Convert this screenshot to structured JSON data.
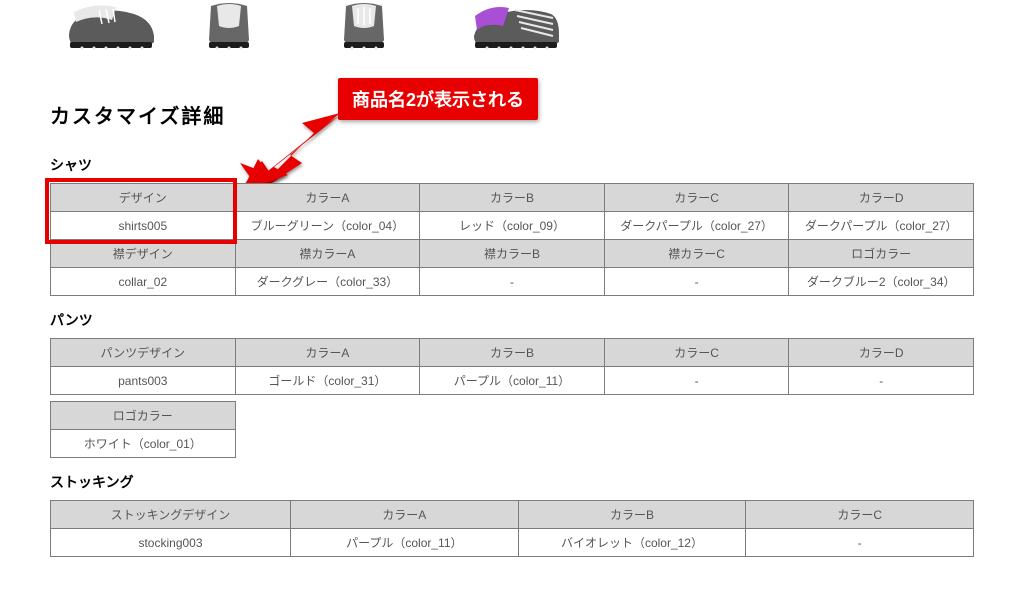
{
  "callout_text": "商品名2が表示される",
  "section_title": "カスタマイズ詳細",
  "shirts": {
    "label": "シャツ",
    "row1_headers": [
      "デザイン",
      "カラーA",
      "カラーB",
      "カラーC",
      "カラーD"
    ],
    "row1_values": [
      "shirts005",
      "ブルーグリーン（color_04）",
      "レッド（color_09）",
      "ダークパープル（color_27）",
      "ダークパープル（color_27）"
    ],
    "row2_headers": [
      "襟デザイン",
      "襟カラーA",
      "襟カラーB",
      "襟カラーC",
      "ロゴカラー"
    ],
    "row2_values": [
      "collar_02",
      "ダークグレー（color_33）",
      "-",
      "-",
      "ダークブルー2（color_34）"
    ]
  },
  "pants": {
    "label": "パンツ",
    "row1_headers": [
      "パンツデザイン",
      "カラーA",
      "カラーB",
      "カラーC",
      "カラーD"
    ],
    "row1_values": [
      "pants003",
      "ゴールド（color_31）",
      "パープル（color_11）",
      "-",
      "-"
    ],
    "extra_header": "ロゴカラー",
    "extra_value": "ホワイト（color_01）"
  },
  "stocking": {
    "label": "ストッキング",
    "headers": [
      "ストッキングデザイン",
      "カラーA",
      "カラーB",
      "カラーC"
    ],
    "values": [
      "stocking003",
      "パープル（color_11）",
      "バイオレット（color_12）",
      "-"
    ]
  }
}
